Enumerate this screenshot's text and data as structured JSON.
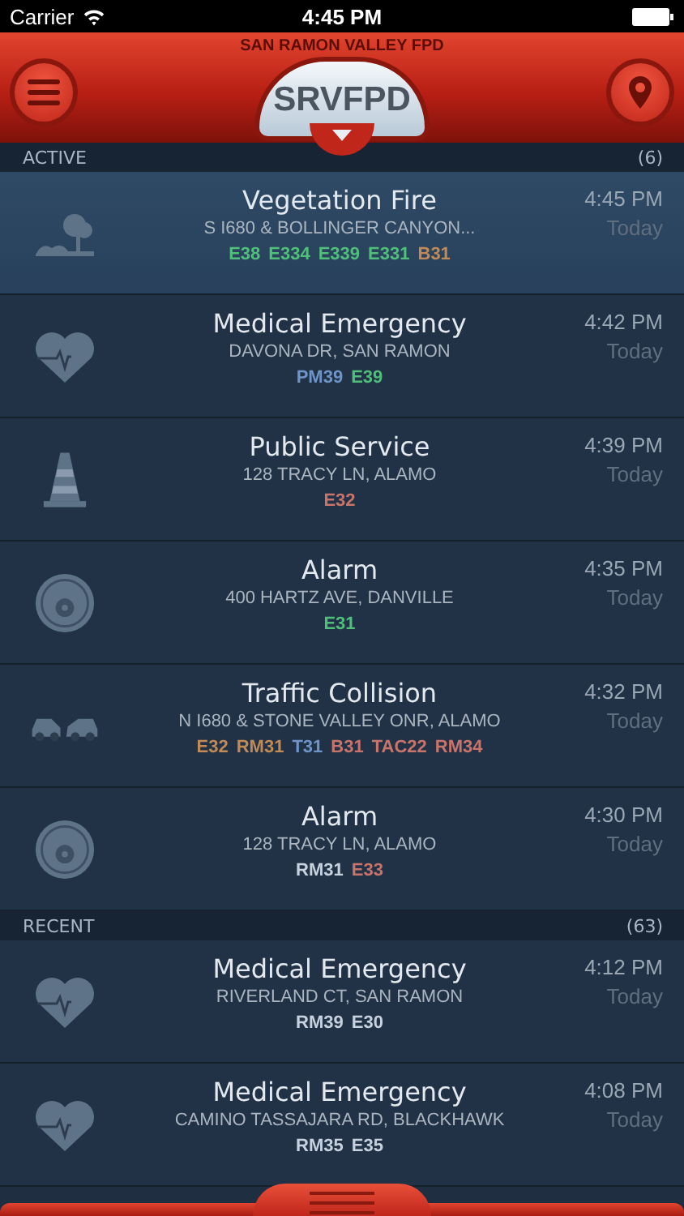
{
  "status_bar": {
    "carrier": "Carrier",
    "time": "4:45 PM"
  },
  "header": {
    "agency": "SAN RAMON VALLEY FPD",
    "logo": "SRVFPD"
  },
  "sections": [
    {
      "title": "ACTIVE",
      "count": "(6)",
      "incidents": [
        {
          "kind": "vegetation",
          "selected": true,
          "title": "Vegetation Fire",
          "address": "S I680 & BOLLINGER CANYON...",
          "time": "4:45 PM",
          "day": "Today",
          "units": [
            {
              "name": "E38",
              "color": "#4fbf7a"
            },
            {
              "name": "E334",
              "color": "#4fbf7a"
            },
            {
              "name": "E339",
              "color": "#4fbf7a"
            },
            {
              "name": "E331",
              "color": "#4fbf7a"
            },
            {
              "name": "B31",
              "color": "#c28a55"
            }
          ]
        },
        {
          "kind": "medical",
          "selected": false,
          "title": "Medical Emergency",
          "address": "DAVONA DR, SAN RAMON",
          "time": "4:42 PM",
          "day": "Today",
          "units": [
            {
              "name": "PM39",
              "color": "#6f95c8"
            },
            {
              "name": "E39",
              "color": "#4fbf7a"
            }
          ]
        },
        {
          "kind": "cone",
          "selected": false,
          "title": "Public Service",
          "address": "128 TRACY LN, ALAMO",
          "time": "4:39 PM",
          "day": "Today",
          "units": [
            {
              "name": "E32",
              "color": "#c8746a"
            }
          ]
        },
        {
          "kind": "alarm",
          "selected": false,
          "title": "Alarm",
          "address": "400 HARTZ AVE, DANVILLE",
          "time": "4:35 PM",
          "day": "Today",
          "units": [
            {
              "name": "E31",
              "color": "#4fbf7a"
            }
          ]
        },
        {
          "kind": "collision",
          "selected": false,
          "title": "Traffic Collision",
          "address": "N I680 & STONE VALLEY ONR, ALAMO",
          "time": "4:32 PM",
          "day": "Today",
          "units": [
            {
              "name": "E32",
              "color": "#c28a55"
            },
            {
              "name": "RM31",
              "color": "#c28a55"
            },
            {
              "name": "T31",
              "color": "#6f95c8"
            },
            {
              "name": "B31",
              "color": "#c8746a"
            },
            {
              "name": "TAC22",
              "color": "#c8746a"
            },
            {
              "name": "RM34",
              "color": "#c8746a"
            }
          ]
        },
        {
          "kind": "alarm",
          "selected": false,
          "title": "Alarm",
          "address": "128 TRACY LN, ALAMO",
          "time": "4:30 PM",
          "day": "Today",
          "units": [
            {
              "name": "RM31",
              "color": "#c8d2de"
            },
            {
              "name": "E33",
              "color": "#c8746a"
            }
          ]
        }
      ]
    },
    {
      "title": "RECENT",
      "count": "(63)",
      "incidents": [
        {
          "kind": "medical",
          "selected": false,
          "title": "Medical Emergency",
          "address": "RIVERLAND CT, SAN RAMON",
          "time": "4:12 PM",
          "day": "Today",
          "units": [
            {
              "name": "RM39",
              "color": "#c8d2de"
            },
            {
              "name": "E30",
              "color": "#c8d2de"
            }
          ]
        },
        {
          "kind": "medical",
          "selected": false,
          "title": "Medical Emergency",
          "address": "CAMINO TASSAJARA RD, BLACKHAWK",
          "time": "4:08 PM",
          "day": "Today",
          "units": [
            {
              "name": "RM35",
              "color": "#c8d2de"
            },
            {
              "name": "E35",
              "color": "#c8d2de"
            }
          ]
        }
      ]
    }
  ]
}
